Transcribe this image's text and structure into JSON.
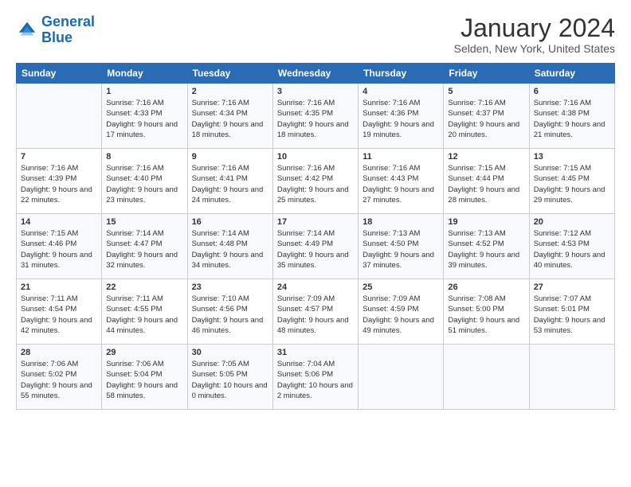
{
  "logo": {
    "line1": "General",
    "line2": "Blue"
  },
  "title": "January 2024",
  "location": "Selden, New York, United States",
  "days_of_week": [
    "Sunday",
    "Monday",
    "Tuesday",
    "Wednesday",
    "Thursday",
    "Friday",
    "Saturday"
  ],
  "weeks": [
    [
      {
        "day": "",
        "sunrise": "",
        "sunset": "",
        "daylight": ""
      },
      {
        "day": "1",
        "sunrise": "Sunrise: 7:16 AM",
        "sunset": "Sunset: 4:33 PM",
        "daylight": "Daylight: 9 hours and 17 minutes."
      },
      {
        "day": "2",
        "sunrise": "Sunrise: 7:16 AM",
        "sunset": "Sunset: 4:34 PM",
        "daylight": "Daylight: 9 hours and 18 minutes."
      },
      {
        "day": "3",
        "sunrise": "Sunrise: 7:16 AM",
        "sunset": "Sunset: 4:35 PM",
        "daylight": "Daylight: 9 hours and 18 minutes."
      },
      {
        "day": "4",
        "sunrise": "Sunrise: 7:16 AM",
        "sunset": "Sunset: 4:36 PM",
        "daylight": "Daylight: 9 hours and 19 minutes."
      },
      {
        "day": "5",
        "sunrise": "Sunrise: 7:16 AM",
        "sunset": "Sunset: 4:37 PM",
        "daylight": "Daylight: 9 hours and 20 minutes."
      },
      {
        "day": "6",
        "sunrise": "Sunrise: 7:16 AM",
        "sunset": "Sunset: 4:38 PM",
        "daylight": "Daylight: 9 hours and 21 minutes."
      }
    ],
    [
      {
        "day": "7",
        "sunrise": "Sunrise: 7:16 AM",
        "sunset": "Sunset: 4:39 PM",
        "daylight": "Daylight: 9 hours and 22 minutes."
      },
      {
        "day": "8",
        "sunrise": "Sunrise: 7:16 AM",
        "sunset": "Sunset: 4:40 PM",
        "daylight": "Daylight: 9 hours and 23 minutes."
      },
      {
        "day": "9",
        "sunrise": "Sunrise: 7:16 AM",
        "sunset": "Sunset: 4:41 PM",
        "daylight": "Daylight: 9 hours and 24 minutes."
      },
      {
        "day": "10",
        "sunrise": "Sunrise: 7:16 AM",
        "sunset": "Sunset: 4:42 PM",
        "daylight": "Daylight: 9 hours and 25 minutes."
      },
      {
        "day": "11",
        "sunrise": "Sunrise: 7:16 AM",
        "sunset": "Sunset: 4:43 PM",
        "daylight": "Daylight: 9 hours and 27 minutes."
      },
      {
        "day": "12",
        "sunrise": "Sunrise: 7:15 AM",
        "sunset": "Sunset: 4:44 PM",
        "daylight": "Daylight: 9 hours and 28 minutes."
      },
      {
        "day": "13",
        "sunrise": "Sunrise: 7:15 AM",
        "sunset": "Sunset: 4:45 PM",
        "daylight": "Daylight: 9 hours and 29 minutes."
      }
    ],
    [
      {
        "day": "14",
        "sunrise": "Sunrise: 7:15 AM",
        "sunset": "Sunset: 4:46 PM",
        "daylight": "Daylight: 9 hours and 31 minutes."
      },
      {
        "day": "15",
        "sunrise": "Sunrise: 7:14 AM",
        "sunset": "Sunset: 4:47 PM",
        "daylight": "Daylight: 9 hours and 32 minutes."
      },
      {
        "day": "16",
        "sunrise": "Sunrise: 7:14 AM",
        "sunset": "Sunset: 4:48 PM",
        "daylight": "Daylight: 9 hours and 34 minutes."
      },
      {
        "day": "17",
        "sunrise": "Sunrise: 7:14 AM",
        "sunset": "Sunset: 4:49 PM",
        "daylight": "Daylight: 9 hours and 35 minutes."
      },
      {
        "day": "18",
        "sunrise": "Sunrise: 7:13 AM",
        "sunset": "Sunset: 4:50 PM",
        "daylight": "Daylight: 9 hours and 37 minutes."
      },
      {
        "day": "19",
        "sunrise": "Sunrise: 7:13 AM",
        "sunset": "Sunset: 4:52 PM",
        "daylight": "Daylight: 9 hours and 39 minutes."
      },
      {
        "day": "20",
        "sunrise": "Sunrise: 7:12 AM",
        "sunset": "Sunset: 4:53 PM",
        "daylight": "Daylight: 9 hours and 40 minutes."
      }
    ],
    [
      {
        "day": "21",
        "sunrise": "Sunrise: 7:11 AM",
        "sunset": "Sunset: 4:54 PM",
        "daylight": "Daylight: 9 hours and 42 minutes."
      },
      {
        "day": "22",
        "sunrise": "Sunrise: 7:11 AM",
        "sunset": "Sunset: 4:55 PM",
        "daylight": "Daylight: 9 hours and 44 minutes."
      },
      {
        "day": "23",
        "sunrise": "Sunrise: 7:10 AM",
        "sunset": "Sunset: 4:56 PM",
        "daylight": "Daylight: 9 hours and 46 minutes."
      },
      {
        "day": "24",
        "sunrise": "Sunrise: 7:09 AM",
        "sunset": "Sunset: 4:57 PM",
        "daylight": "Daylight: 9 hours and 48 minutes."
      },
      {
        "day": "25",
        "sunrise": "Sunrise: 7:09 AM",
        "sunset": "Sunset: 4:59 PM",
        "daylight": "Daylight: 9 hours and 49 minutes."
      },
      {
        "day": "26",
        "sunrise": "Sunrise: 7:08 AM",
        "sunset": "Sunset: 5:00 PM",
        "daylight": "Daylight: 9 hours and 51 minutes."
      },
      {
        "day": "27",
        "sunrise": "Sunrise: 7:07 AM",
        "sunset": "Sunset: 5:01 PM",
        "daylight": "Daylight: 9 hours and 53 minutes."
      }
    ],
    [
      {
        "day": "28",
        "sunrise": "Sunrise: 7:06 AM",
        "sunset": "Sunset: 5:02 PM",
        "daylight": "Daylight: 9 hours and 55 minutes."
      },
      {
        "day": "29",
        "sunrise": "Sunrise: 7:06 AM",
        "sunset": "Sunset: 5:04 PM",
        "daylight": "Daylight: 9 hours and 58 minutes."
      },
      {
        "day": "30",
        "sunrise": "Sunrise: 7:05 AM",
        "sunset": "Sunset: 5:05 PM",
        "daylight": "Daylight: 10 hours and 0 minutes."
      },
      {
        "day": "31",
        "sunrise": "Sunrise: 7:04 AM",
        "sunset": "Sunset: 5:06 PM",
        "daylight": "Daylight: 10 hours and 2 minutes."
      },
      {
        "day": "",
        "sunrise": "",
        "sunset": "",
        "daylight": ""
      },
      {
        "day": "",
        "sunrise": "",
        "sunset": "",
        "daylight": ""
      },
      {
        "day": "",
        "sunrise": "",
        "sunset": "",
        "daylight": ""
      }
    ]
  ]
}
